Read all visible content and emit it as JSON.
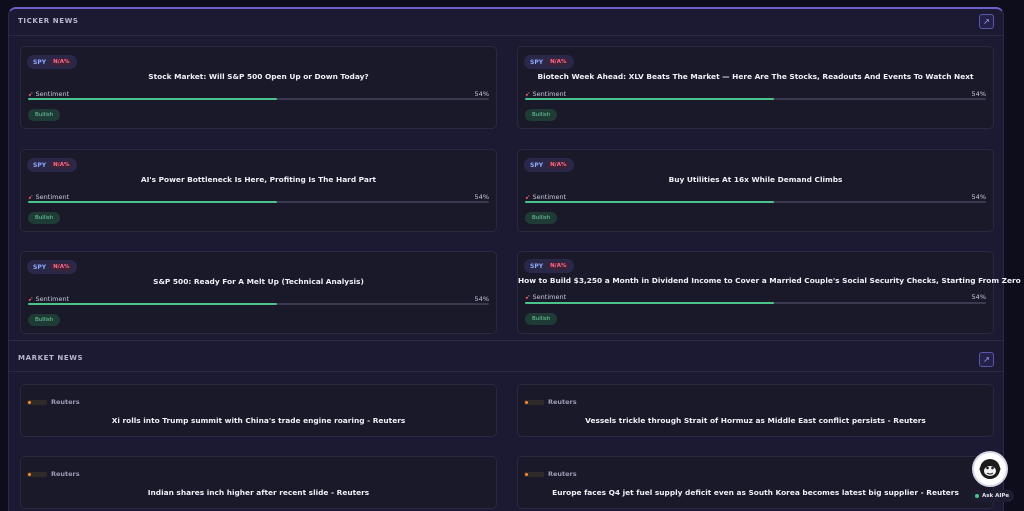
{
  "ticker_news": {
    "title": "TICKER NEWS",
    "sentiment_label": "Sentiment",
    "cards": [
      {
        "ticker": "SPY",
        "pct": "N/A%",
        "headline": "Stock Market: Will S&P 500 Open Up or Down Today?",
        "sentiment_pct": "54%",
        "sentiment_value": 54,
        "badge": "Bullish"
      },
      {
        "ticker": "SPY",
        "pct": "N/A%",
        "headline": "Biotech Week Ahead: XLV Beats The Market — Here Are The Stocks, Readouts And Events To Watch Next",
        "sentiment_pct": "54%",
        "sentiment_value": 54,
        "badge": "Bullish"
      },
      {
        "ticker": "SPY",
        "pct": "N/A%",
        "headline": "AI's Power Bottleneck Is Here, Profiting Is The Hard Part",
        "sentiment_pct": "54%",
        "sentiment_value": 54,
        "badge": "Bullish"
      },
      {
        "ticker": "SPY",
        "pct": "N/A%",
        "headline": "Buy Utilities At 16x While Demand Climbs",
        "sentiment_pct": "54%",
        "sentiment_value": 54,
        "badge": "Bullish"
      },
      {
        "ticker": "SPY",
        "pct": "N/A%",
        "headline": "S&P 500: Ready For A Melt Up (Technical Analysis)",
        "sentiment_pct": "54%",
        "sentiment_value": 54,
        "badge": "Bullish"
      },
      {
        "ticker": "SPY",
        "pct": "N/A%",
        "headline": "How to Build $3,250 a Month in Dividend Income to Cover a Married Couple's Social Security Checks, Starting From Zero",
        "sentiment_pct": "54%",
        "sentiment_value": 54,
        "badge": "Bullish"
      }
    ]
  },
  "market_news": {
    "title": "MARKET NEWS",
    "cards": [
      {
        "source": "Reuters",
        "headline": "Xi rolls into Trump summit with China's trade engine roaring - Reuters"
      },
      {
        "source": "Reuters",
        "headline": "Vessels trickle through Strait of Hormuz as Middle East conflict persists - Reuters"
      },
      {
        "source": "Reuters",
        "headline": "Indian shares inch higher after recent slide - Reuters"
      },
      {
        "source": "Reuters",
        "headline": "Europe faces Q4 jet fuel supply deficit even as South Korea becomes latest big supplier - Reuters"
      }
    ]
  },
  "assistant": {
    "label": "Ask AIPe"
  },
  "colors": {
    "accent": "#6b63c7",
    "positive": "#4cc38a",
    "negative": "#ff6b8b",
    "ticker": "#8fa8ff"
  },
  "icons": {
    "external": "external-link-icon",
    "sentiment": "dart-icon",
    "assistant": "monkey-avatar-icon"
  }
}
